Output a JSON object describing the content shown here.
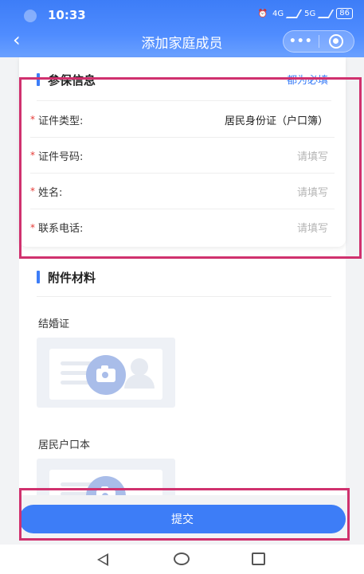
{
  "status_bar": {
    "time": "10:33",
    "net1": "4G",
    "net2": "5G",
    "battery": "86"
  },
  "nav": {
    "back_icon": "‹",
    "title": "添加家庭成员",
    "more_icon": "•••"
  },
  "insurance_section": {
    "title": "参保信息",
    "required_note": "都为必填",
    "fields": [
      {
        "required": "*",
        "label": "证件类型:",
        "value": "居民身份证（户口簿）",
        "placeholder": ""
      },
      {
        "required": "*",
        "label": "证件号码:",
        "value": "",
        "placeholder": "请填写"
      },
      {
        "required": "*",
        "label": "姓名:",
        "value": "",
        "placeholder": "请填写"
      },
      {
        "required": "*",
        "label": "联系电话:",
        "value": "",
        "placeholder": "请填写"
      }
    ]
  },
  "attachments_section": {
    "title": "附件材料",
    "items": [
      {
        "label": "结婚证"
      },
      {
        "label": "居民户口本"
      }
    ]
  },
  "footer": {
    "submit_label": "提交"
  },
  "colors": {
    "accent": "#3d7df7",
    "required": "#e53935",
    "highlight": "#d0316e"
  }
}
